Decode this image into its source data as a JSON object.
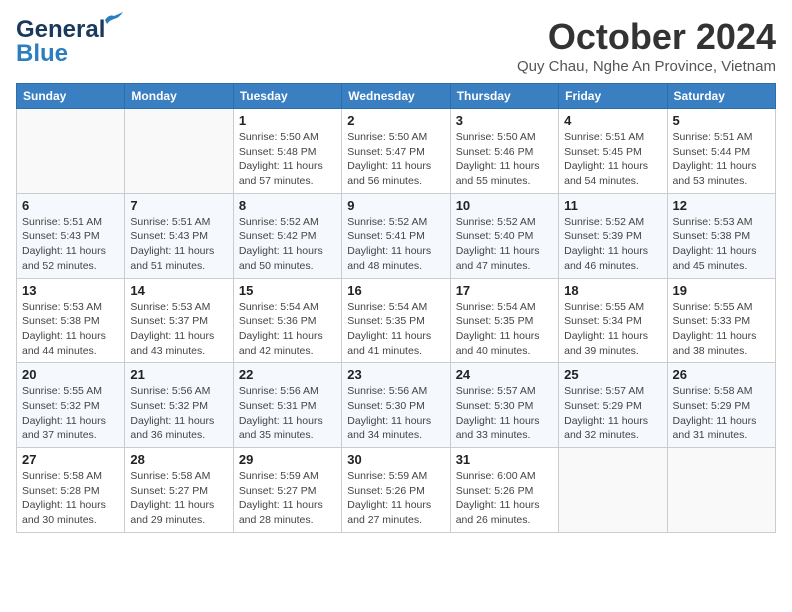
{
  "header": {
    "logo_line1": "General",
    "logo_line2": "Blue",
    "month": "October 2024",
    "location": "Quy Chau, Nghe An Province, Vietnam"
  },
  "days_of_week": [
    "Sunday",
    "Monday",
    "Tuesday",
    "Wednesday",
    "Thursday",
    "Friday",
    "Saturday"
  ],
  "weeks": [
    [
      {
        "day": "",
        "info": ""
      },
      {
        "day": "",
        "info": ""
      },
      {
        "day": "1",
        "info": "Sunrise: 5:50 AM\nSunset: 5:48 PM\nDaylight: 11 hours\nand 57 minutes."
      },
      {
        "day": "2",
        "info": "Sunrise: 5:50 AM\nSunset: 5:47 PM\nDaylight: 11 hours\nand 56 minutes."
      },
      {
        "day": "3",
        "info": "Sunrise: 5:50 AM\nSunset: 5:46 PM\nDaylight: 11 hours\nand 55 minutes."
      },
      {
        "day": "4",
        "info": "Sunrise: 5:51 AM\nSunset: 5:45 PM\nDaylight: 11 hours\nand 54 minutes."
      },
      {
        "day": "5",
        "info": "Sunrise: 5:51 AM\nSunset: 5:44 PM\nDaylight: 11 hours\nand 53 minutes."
      }
    ],
    [
      {
        "day": "6",
        "info": "Sunrise: 5:51 AM\nSunset: 5:43 PM\nDaylight: 11 hours\nand 52 minutes."
      },
      {
        "day": "7",
        "info": "Sunrise: 5:51 AM\nSunset: 5:43 PM\nDaylight: 11 hours\nand 51 minutes."
      },
      {
        "day": "8",
        "info": "Sunrise: 5:52 AM\nSunset: 5:42 PM\nDaylight: 11 hours\nand 50 minutes."
      },
      {
        "day": "9",
        "info": "Sunrise: 5:52 AM\nSunset: 5:41 PM\nDaylight: 11 hours\nand 48 minutes."
      },
      {
        "day": "10",
        "info": "Sunrise: 5:52 AM\nSunset: 5:40 PM\nDaylight: 11 hours\nand 47 minutes."
      },
      {
        "day": "11",
        "info": "Sunrise: 5:52 AM\nSunset: 5:39 PM\nDaylight: 11 hours\nand 46 minutes."
      },
      {
        "day": "12",
        "info": "Sunrise: 5:53 AM\nSunset: 5:38 PM\nDaylight: 11 hours\nand 45 minutes."
      }
    ],
    [
      {
        "day": "13",
        "info": "Sunrise: 5:53 AM\nSunset: 5:38 PM\nDaylight: 11 hours\nand 44 minutes."
      },
      {
        "day": "14",
        "info": "Sunrise: 5:53 AM\nSunset: 5:37 PM\nDaylight: 11 hours\nand 43 minutes."
      },
      {
        "day": "15",
        "info": "Sunrise: 5:54 AM\nSunset: 5:36 PM\nDaylight: 11 hours\nand 42 minutes."
      },
      {
        "day": "16",
        "info": "Sunrise: 5:54 AM\nSunset: 5:35 PM\nDaylight: 11 hours\nand 41 minutes."
      },
      {
        "day": "17",
        "info": "Sunrise: 5:54 AM\nSunset: 5:35 PM\nDaylight: 11 hours\nand 40 minutes."
      },
      {
        "day": "18",
        "info": "Sunrise: 5:55 AM\nSunset: 5:34 PM\nDaylight: 11 hours\nand 39 minutes."
      },
      {
        "day": "19",
        "info": "Sunrise: 5:55 AM\nSunset: 5:33 PM\nDaylight: 11 hours\nand 38 minutes."
      }
    ],
    [
      {
        "day": "20",
        "info": "Sunrise: 5:55 AM\nSunset: 5:32 PM\nDaylight: 11 hours\nand 37 minutes."
      },
      {
        "day": "21",
        "info": "Sunrise: 5:56 AM\nSunset: 5:32 PM\nDaylight: 11 hours\nand 36 minutes."
      },
      {
        "day": "22",
        "info": "Sunrise: 5:56 AM\nSunset: 5:31 PM\nDaylight: 11 hours\nand 35 minutes."
      },
      {
        "day": "23",
        "info": "Sunrise: 5:56 AM\nSunset: 5:30 PM\nDaylight: 11 hours\nand 34 minutes."
      },
      {
        "day": "24",
        "info": "Sunrise: 5:57 AM\nSunset: 5:30 PM\nDaylight: 11 hours\nand 33 minutes."
      },
      {
        "day": "25",
        "info": "Sunrise: 5:57 AM\nSunset: 5:29 PM\nDaylight: 11 hours\nand 32 minutes."
      },
      {
        "day": "26",
        "info": "Sunrise: 5:58 AM\nSunset: 5:29 PM\nDaylight: 11 hours\nand 31 minutes."
      }
    ],
    [
      {
        "day": "27",
        "info": "Sunrise: 5:58 AM\nSunset: 5:28 PM\nDaylight: 11 hours\nand 30 minutes."
      },
      {
        "day": "28",
        "info": "Sunrise: 5:58 AM\nSunset: 5:27 PM\nDaylight: 11 hours\nand 29 minutes."
      },
      {
        "day": "29",
        "info": "Sunrise: 5:59 AM\nSunset: 5:27 PM\nDaylight: 11 hours\nand 28 minutes."
      },
      {
        "day": "30",
        "info": "Sunrise: 5:59 AM\nSunset: 5:26 PM\nDaylight: 11 hours\nand 27 minutes."
      },
      {
        "day": "31",
        "info": "Sunrise: 6:00 AM\nSunset: 5:26 PM\nDaylight: 11 hours\nand 26 minutes."
      },
      {
        "day": "",
        "info": ""
      },
      {
        "day": "",
        "info": ""
      }
    ]
  ]
}
